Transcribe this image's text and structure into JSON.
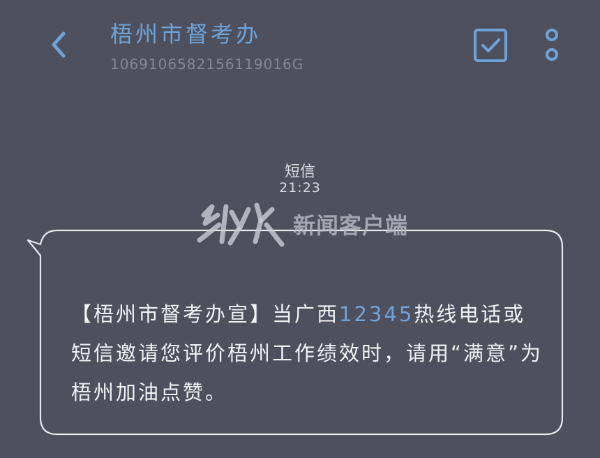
{
  "header": {
    "contact_name": "梧州市督考办",
    "contact_number": "1069106582156119016G"
  },
  "meta": {
    "label": "短信",
    "time": "21:23"
  },
  "watermark": {
    "text": "新闻客户端"
  },
  "message": {
    "part1": "【梧州市督考办宣】当广西",
    "highlight": "12345",
    "part2": "热线电话或短信邀请您评价梧州工作绩效时，请用“满意”为梧州加油点赞。"
  },
  "colors": {
    "background": "#4e505e",
    "accent": "#6fa3d8",
    "bubble_border": "#e8e8ee"
  },
  "icons": {
    "back": "chevron-left-icon",
    "check": "checkbox-icon",
    "more": "more-vertical-icon"
  }
}
